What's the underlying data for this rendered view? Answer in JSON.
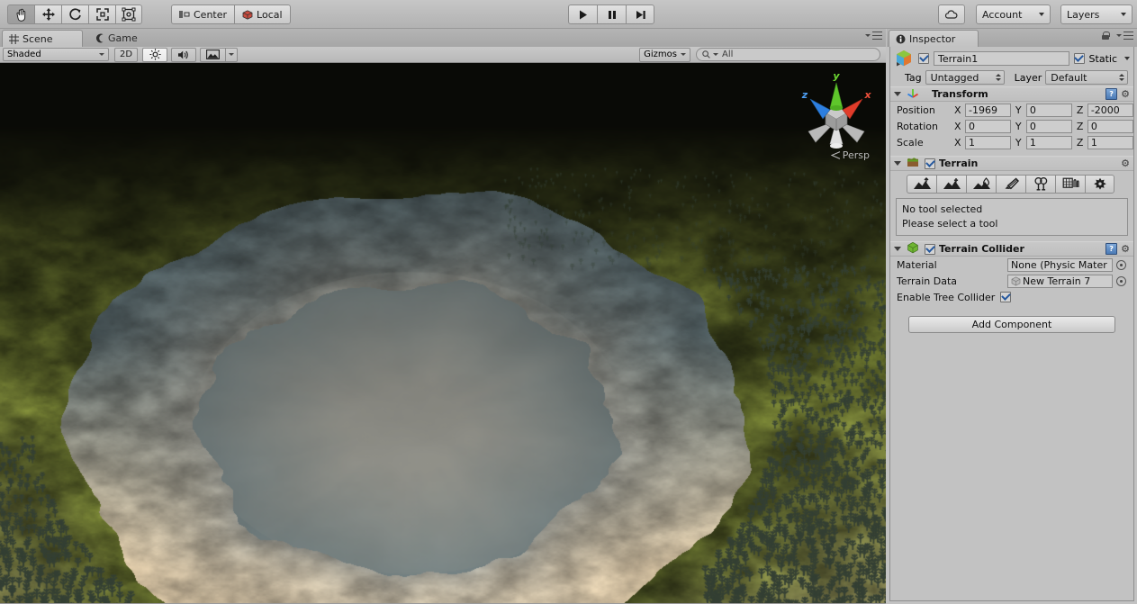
{
  "app": {
    "title": "Unity Editor"
  },
  "toolbar": {
    "transform_tools": [
      {
        "name": "hand-tool",
        "selected": true
      },
      {
        "name": "move-tool",
        "selected": false
      },
      {
        "name": "rotate-tool",
        "selected": false
      },
      {
        "name": "scale-tool",
        "selected": false
      },
      {
        "name": "rect-tool",
        "selected": false
      }
    ],
    "pivot_mode": "Center",
    "pivot_rotation": "Local",
    "play_controls": [
      {
        "name": "play-button",
        "glyph": "play"
      },
      {
        "name": "pause-button",
        "glyph": "pause"
      },
      {
        "name": "step-button",
        "glyph": "step"
      }
    ],
    "cloud_label": "",
    "account_label": "Account",
    "layers_label": "Layers"
  },
  "scene": {
    "tabs": [
      {
        "label": "Scene",
        "icon": "grid-icon",
        "active": true
      },
      {
        "label": "Game",
        "icon": "gamepad-icon",
        "active": false
      }
    ],
    "draw_mode": "Shaded",
    "toggle_2d": "2D",
    "lighting_icon": "sun-icon",
    "audio_icon": "speaker-icon",
    "fx_icon": "image-icon",
    "gizmos_label": "Gizmos",
    "search_placeholder": "All",
    "search_value": "All",
    "gizmo_axes": {
      "x": "x",
      "y": "y",
      "z": "z"
    },
    "projection_label": "Persp",
    "viewport_colors": {
      "sky": "#0d0e08",
      "grass_dark": "#2a2f14",
      "grass_light": "#6f7a31",
      "water": "#5a6a6e",
      "crater_floor": "#8a8a83",
      "sand": "#d8c2a0",
      "tree": "#343f34"
    }
  },
  "inspector": {
    "tab_label": "Inspector",
    "lock_icon": "lock-icon",
    "menu_icon": "hamburger-icon",
    "object": {
      "enabled": true,
      "name": "Terrain1",
      "static_label": "Static",
      "static_checked": true,
      "tag_label": "Tag",
      "tag_value": "Untagged",
      "layer_label": "Layer",
      "layer_value": "Default"
    },
    "components": [
      {
        "id": "transform",
        "title": "Transform",
        "icon": "transform-axis-icon",
        "expanded": true,
        "has_help": true,
        "rows": [
          {
            "label": "Position",
            "x": "-1969",
            "y": "0",
            "z": "-2000"
          },
          {
            "label": "Rotation",
            "x": "0",
            "y": "0",
            "z": "0"
          },
          {
            "label": "Scale",
            "x": "1",
            "y": "1",
            "z": "1"
          }
        ]
      },
      {
        "id": "terrain",
        "title": "Terrain",
        "icon": "terrain-icon",
        "expanded": true,
        "enabled": true,
        "has_help": false,
        "tools": [
          {
            "name": "raise-lower-terrain-tool"
          },
          {
            "name": "paint-height-tool"
          },
          {
            "name": "smooth-height-tool"
          },
          {
            "name": "paint-texture-tool"
          },
          {
            "name": "place-trees-tool"
          },
          {
            "name": "paint-details-tool"
          },
          {
            "name": "terrain-settings-tool"
          }
        ],
        "help_title": "No tool selected",
        "help_body": "Please select a tool"
      },
      {
        "id": "terrain-collider",
        "title": "Terrain Collider",
        "icon": "collider-icon",
        "expanded": true,
        "enabled": true,
        "has_help": true,
        "fields": [
          {
            "label": "Material",
            "value": "None (Physic Mater",
            "type": "object"
          },
          {
            "label": "Terrain Data",
            "value": "New Terrain 7",
            "type": "object-asset"
          },
          {
            "label": "Enable Tree Collider",
            "value": true,
            "type": "checkbox"
          }
        ]
      }
    ],
    "add_component_label": "Add Component"
  }
}
